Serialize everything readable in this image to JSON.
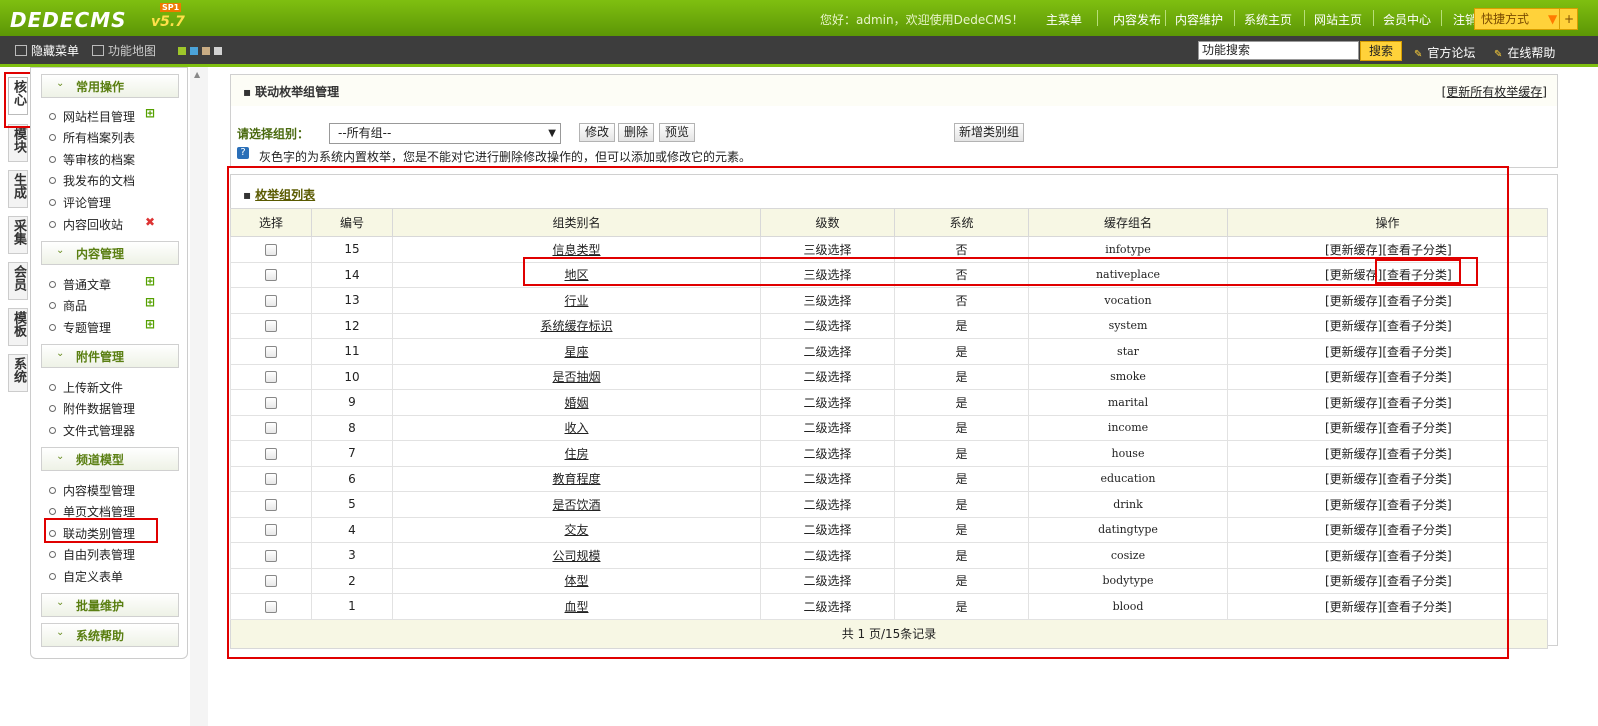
{
  "header": {
    "logo": "DEDECMS",
    "version": "v5.7",
    "sp": "SP1",
    "welcome": "您好：admin，欢迎使用DedeCMS！",
    "nav": [
      "主菜单",
      "内容发布",
      "内容维护",
      "系统主页",
      "网站主页",
      "会员中心",
      "注销"
    ],
    "quick": "快捷方式"
  },
  "toolbar": {
    "hide_menu": "隐藏菜单",
    "function_map": "功能地图",
    "search_placeholder": "功能搜索",
    "search_button": "搜索",
    "forum": "官方论坛",
    "help": "在线帮助"
  },
  "vtabs": [
    "核心",
    "模块",
    "生成",
    "采集",
    "会员",
    "模板",
    "系统"
  ],
  "menu": {
    "groups": [
      {
        "title": "常用操作",
        "items": [
          "网站栏目管理",
          "所有档案列表",
          "等审核的档案",
          "我发布的文档",
          "评论管理",
          "内容回收站"
        ]
      },
      {
        "title": "内容管理",
        "items": [
          "普通文章",
          "商品",
          "专题管理"
        ]
      },
      {
        "title": "附件管理",
        "items": [
          "上传新文件",
          "附件数据管理",
          "文件式管理器"
        ]
      },
      {
        "title": "频道模型",
        "items": [
          "内容模型管理",
          "单页文档管理",
          "联动类别管理",
          "自由列表管理",
          "自定义表单"
        ]
      },
      {
        "title": "批量维护",
        "items": []
      },
      {
        "title": "系统帮助",
        "items": []
      }
    ]
  },
  "main": {
    "panel_title": "联动枚举组管理",
    "refresh_all": "[更新所有枚举缓存]",
    "select_label": "请选择组别：",
    "select_value": "--所有组--",
    "btn_edit": "修改",
    "btn_delete": "删除",
    "btn_preview": "预览",
    "btn_new": "新增类别组",
    "note": "灰色字的为系统内置枚举，您是不能对它进行删除修改操作的，但可以添加或修改它的元素。",
    "list_title": "枚举组列表",
    "columns": [
      "选择",
      "编号",
      "组类别名",
      "级数",
      "系统",
      "缓存组名",
      "操作"
    ],
    "rows": [
      {
        "id": "15",
        "name": "信息类型",
        "level": "三级选择",
        "system": "否",
        "cache": "infotype"
      },
      {
        "id": "14",
        "name": "地区",
        "level": "三级选择",
        "system": "否",
        "cache": "nativeplace"
      },
      {
        "id": "13",
        "name": "行业",
        "level": "三级选择",
        "system": "否",
        "cache": "vocation"
      },
      {
        "id": "12",
        "name": "系统缓存标识",
        "level": "二级选择",
        "system": "是",
        "cache": "system"
      },
      {
        "id": "11",
        "name": "星座",
        "level": "二级选择",
        "system": "是",
        "cache": "star"
      },
      {
        "id": "10",
        "name": "是否抽烟",
        "level": "二级选择",
        "system": "是",
        "cache": "smoke"
      },
      {
        "id": "9",
        "name": "婚姻",
        "level": "二级选择",
        "system": "是",
        "cache": "marital"
      },
      {
        "id": "8",
        "name": "收入",
        "level": "二级选择",
        "system": "是",
        "cache": "income"
      },
      {
        "id": "7",
        "name": "住房",
        "level": "二级选择",
        "system": "是",
        "cache": "house"
      },
      {
        "id": "6",
        "name": "教育程度",
        "level": "二级选择",
        "system": "是",
        "cache": "education"
      },
      {
        "id": "5",
        "name": "是否饮酒",
        "level": "二级选择",
        "system": "是",
        "cache": "drink"
      },
      {
        "id": "4",
        "name": "交友",
        "level": "二级选择",
        "system": "是",
        "cache": "datingtype"
      },
      {
        "id": "3",
        "name": "公司规模",
        "level": "二级选择",
        "system": "是",
        "cache": "cosize"
      },
      {
        "id": "2",
        "name": "体型",
        "level": "二级选择",
        "system": "是",
        "cache": "bodytype"
      },
      {
        "id": "1",
        "name": "血型",
        "level": "二级选择",
        "system": "是",
        "cache": "blood"
      }
    ],
    "op_refresh": "[更新缓存]",
    "op_view": "[查看子分类]",
    "footer": "共 1 页/15条记录"
  },
  "colors": {
    "brand_green": "#7fbf10",
    "highlight_red": "#e00000",
    "header_bg": "#f7f7e4"
  }
}
